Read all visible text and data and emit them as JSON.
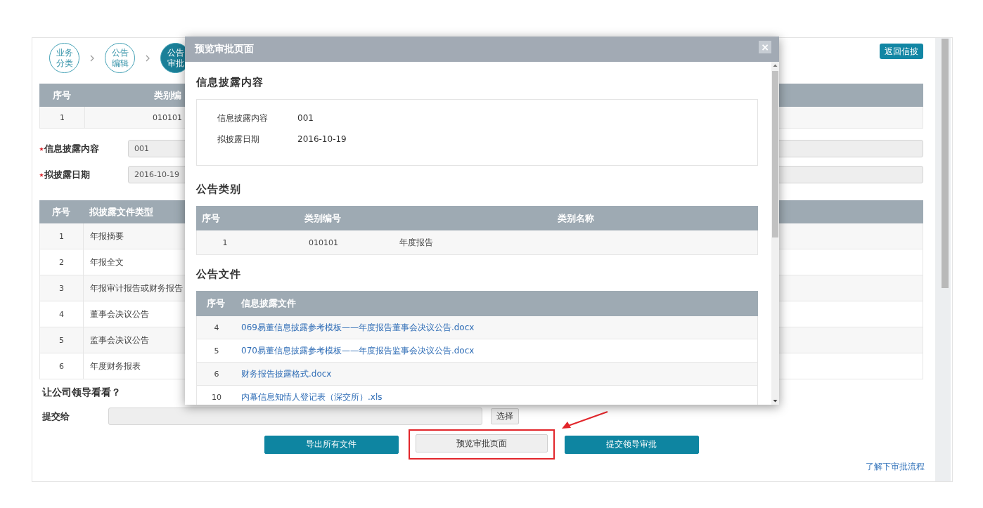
{
  "steps": [
    {
      "label": "业务分类",
      "selected": false
    },
    {
      "label": "公告编辑",
      "selected": false
    },
    {
      "label": "公告审批",
      "selected": true
    }
  ],
  "back_button": "返回信披",
  "category_table": {
    "columns": [
      "序号",
      "类别编"
    ],
    "rows": [
      [
        "1",
        "010101"
      ]
    ]
  },
  "fields": [
    {
      "label": "信息披露内容",
      "required": true,
      "value": "001"
    },
    {
      "label": "拟披露日期",
      "required": true,
      "value": "2016-10-19"
    }
  ],
  "file_type_table": {
    "columns": [
      "序号",
      "拟披露文件类型"
    ],
    "rows": [
      [
        "1",
        "年报摘要"
      ],
      [
        "2",
        "年报全文"
      ],
      [
        "3",
        "年报审计报告或财务报告"
      ],
      [
        "4",
        "董事会决议公告"
      ],
      [
        "5",
        "监事会决议公告"
      ],
      [
        "6",
        "年度财务报表"
      ]
    ]
  },
  "reviewer": {
    "title": "让公司领导看看？",
    "label": "提交给",
    "choose_button": "选择"
  },
  "actions": [
    {
      "label": "导出所有文件",
      "kind": "primary",
      "highlighted": false
    },
    {
      "label": "预览审批页面",
      "kind": "default",
      "highlighted": true
    },
    {
      "label": "提交领导审批",
      "kind": "primary",
      "highlighted": false
    }
  ],
  "help_link": "了解下审批流程",
  "modal": {
    "title": "预览审批页面",
    "close": "×",
    "content_section": {
      "heading": "信息披露内容",
      "items": [
        {
          "label": "信息披露内容",
          "value": "001"
        },
        {
          "label": "拟披露日期",
          "value": "2016-10-19"
        }
      ]
    },
    "category_section": {
      "heading": "公告类别",
      "columns": [
        "序号",
        "类别编号",
        "类别名称"
      ],
      "rows": [
        [
          "1",
          "010101",
          "年度报告"
        ]
      ]
    },
    "files_section": {
      "heading": "公告文件",
      "columns": [
        "序号",
        "信息披露文件"
      ],
      "rows": [
        {
          "number": "4",
          "file": "069易董信息披露参考模板——年度报告董事会决议公告.docx"
        },
        {
          "number": "5",
          "file": "070易董信息披露参考模板——年度报告监事会决议公告.docx"
        },
        {
          "number": "6",
          "file": "财务报告披露格式.docx"
        },
        {
          "number": "10",
          "file": "内幕信息知情人登记表（深交所）.xls"
        }
      ]
    }
  }
}
